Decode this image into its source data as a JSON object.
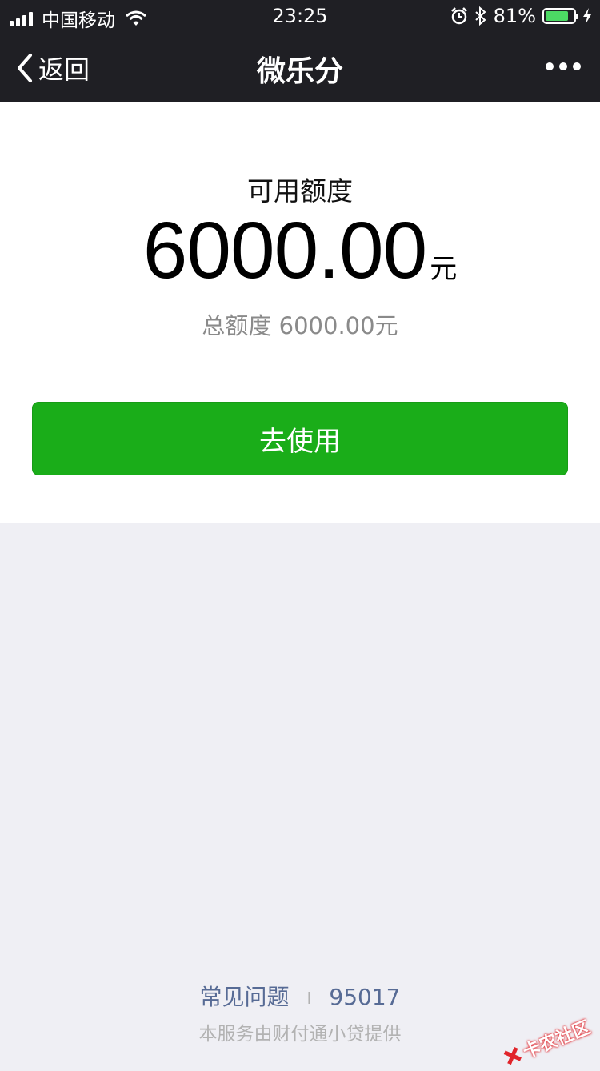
{
  "status_bar": {
    "carrier": "中国移动",
    "time": "23:25",
    "battery_percent": "81%",
    "battery_level": 0.81,
    "icons": [
      "signal-icon",
      "wifi-icon",
      "alarm-icon",
      "bluetooth-icon",
      "battery-icon",
      "charging-icon"
    ]
  },
  "nav": {
    "back_label": "返回",
    "title": "微乐分",
    "more_icon": "more-icon"
  },
  "credit": {
    "available_label": "可用额度",
    "available_amount": "6000.00",
    "unit": "元",
    "total_text": "总额度 6000.00元"
  },
  "action": {
    "use_label": "去使用"
  },
  "footer": {
    "faq_label": "常见问题",
    "separator": "I",
    "phone": "95017",
    "provider": "本服务由财付通小贷提供"
  },
  "watermark": {
    "text": "卡农社区"
  },
  "colors": {
    "nav_background": "#1f1f24",
    "primary_button": "#1aad19",
    "link": "#576b95",
    "page_background": "#efeff4",
    "battery_fill": "#4cd964"
  }
}
